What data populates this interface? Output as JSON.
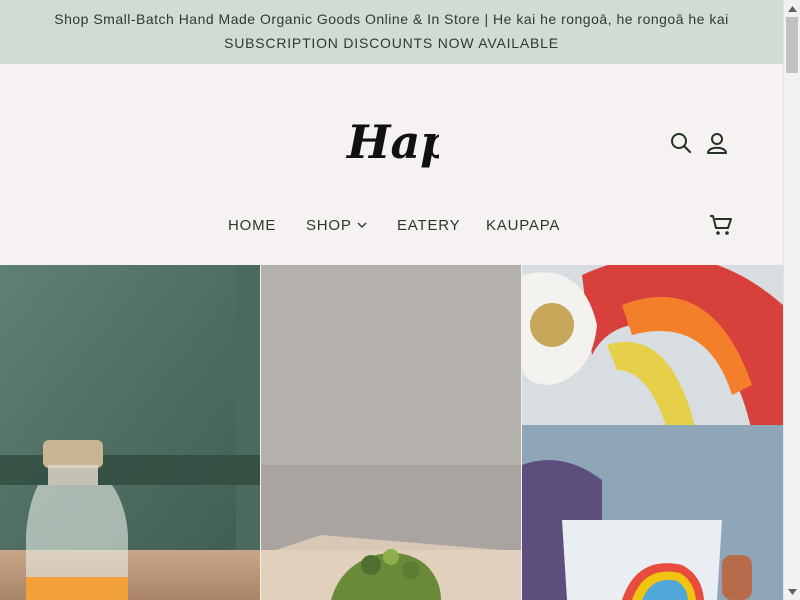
{
  "announcement": {
    "line1": "Shop Small-Batch Hand Made Organic Goods Online & In Store | He kai he rongoā, he rongoā he kai",
    "line2": "SUBSCRIPTION DISCOUNTS NOW AVAILABLE"
  },
  "brand": {
    "logo_text": "Hapi"
  },
  "icons": {
    "search": "search-icon",
    "account": "user-icon",
    "cart": "cart-icon",
    "dropdown": "chevron-down-icon"
  },
  "nav": {
    "home": "HOME",
    "shop": "SHOP",
    "eatery": "EATERY",
    "kaupapa": "KAUPAPA"
  },
  "colors": {
    "announcement_bg": "#d1ddd2",
    "header_bg": "#f5f2f1",
    "nav_text": "#2a3a2a",
    "icon": "#233323"
  }
}
